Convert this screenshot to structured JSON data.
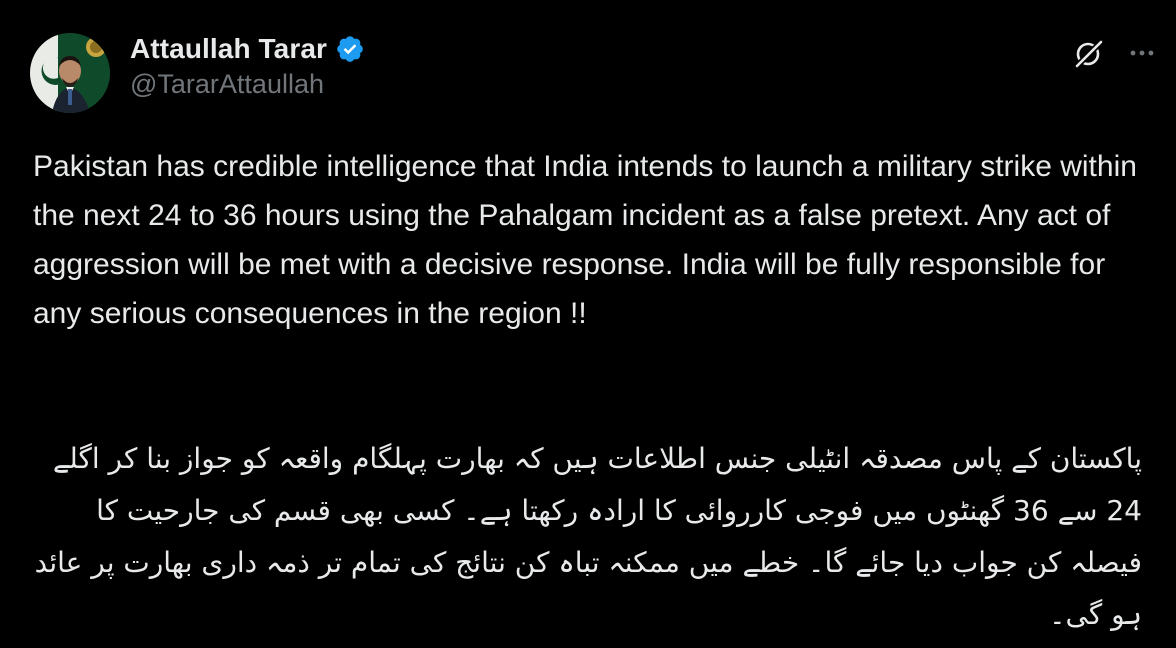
{
  "author": {
    "display_name": "Attaullah Tarar",
    "handle": "@TararAttaullah",
    "verified": true,
    "verified_color": "#1d9bf0",
    "avatar_icon": "profile-avatar"
  },
  "actions": {
    "grok_icon": "grok-icon",
    "more_icon": "more-options-icon"
  },
  "post": {
    "text_en": "Pakistan has credible intelligence that India intends to launch a military strike within the next 24 to 36 hours using the Pahalgam incident as a false pretext. Any act of aggression will be met with a decisive response. India will be fully responsible for any serious consequences in the region !!",
    "text_ur": "پاکستان کے پاس مصدقہ انٹیلی جنس اطلاعات ہیں کہ بھارت پہلگام واقعہ کو جواز بنا کر اگلے 24 سے 36 گھنٹوں میں فوجی کارروائی کا ارادہ رکھتا ہے۔ کسی بھی قسم کی جارحیت کا فیصلہ کن جواب دیا جائے گا۔ خطے میں ممکنہ تباہ کن نتائج کی تمام تر ذمہ داری بھارت پر عائد ہو گی۔"
  },
  "colors": {
    "background": "#000000",
    "primary_text": "#e7e9ea",
    "secondary_text": "#71767b"
  }
}
